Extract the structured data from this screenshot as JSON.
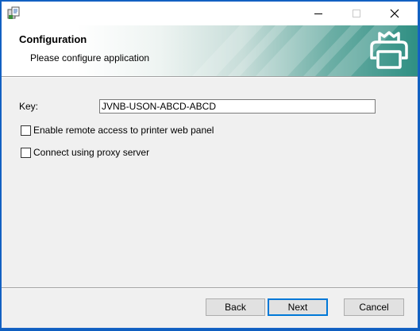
{
  "window": {
    "controls": {
      "minimize": "—",
      "maximize": "☐",
      "close": "✕"
    }
  },
  "banner": {
    "title": "Configuration",
    "subtitle": "Please configure application",
    "icon": "printer-icon",
    "accent_color": "#2f8f83"
  },
  "form": {
    "key_label": "Key:",
    "key_value": "JVNB-USON-ABCD-ABCD",
    "remote_access_label": "Enable remote access to printer web panel",
    "remote_access_checked": false,
    "proxy_label": "Connect using proxy server",
    "proxy_checked": false
  },
  "buttons": {
    "back": "Back",
    "next": "Next",
    "cancel": "Cancel"
  }
}
